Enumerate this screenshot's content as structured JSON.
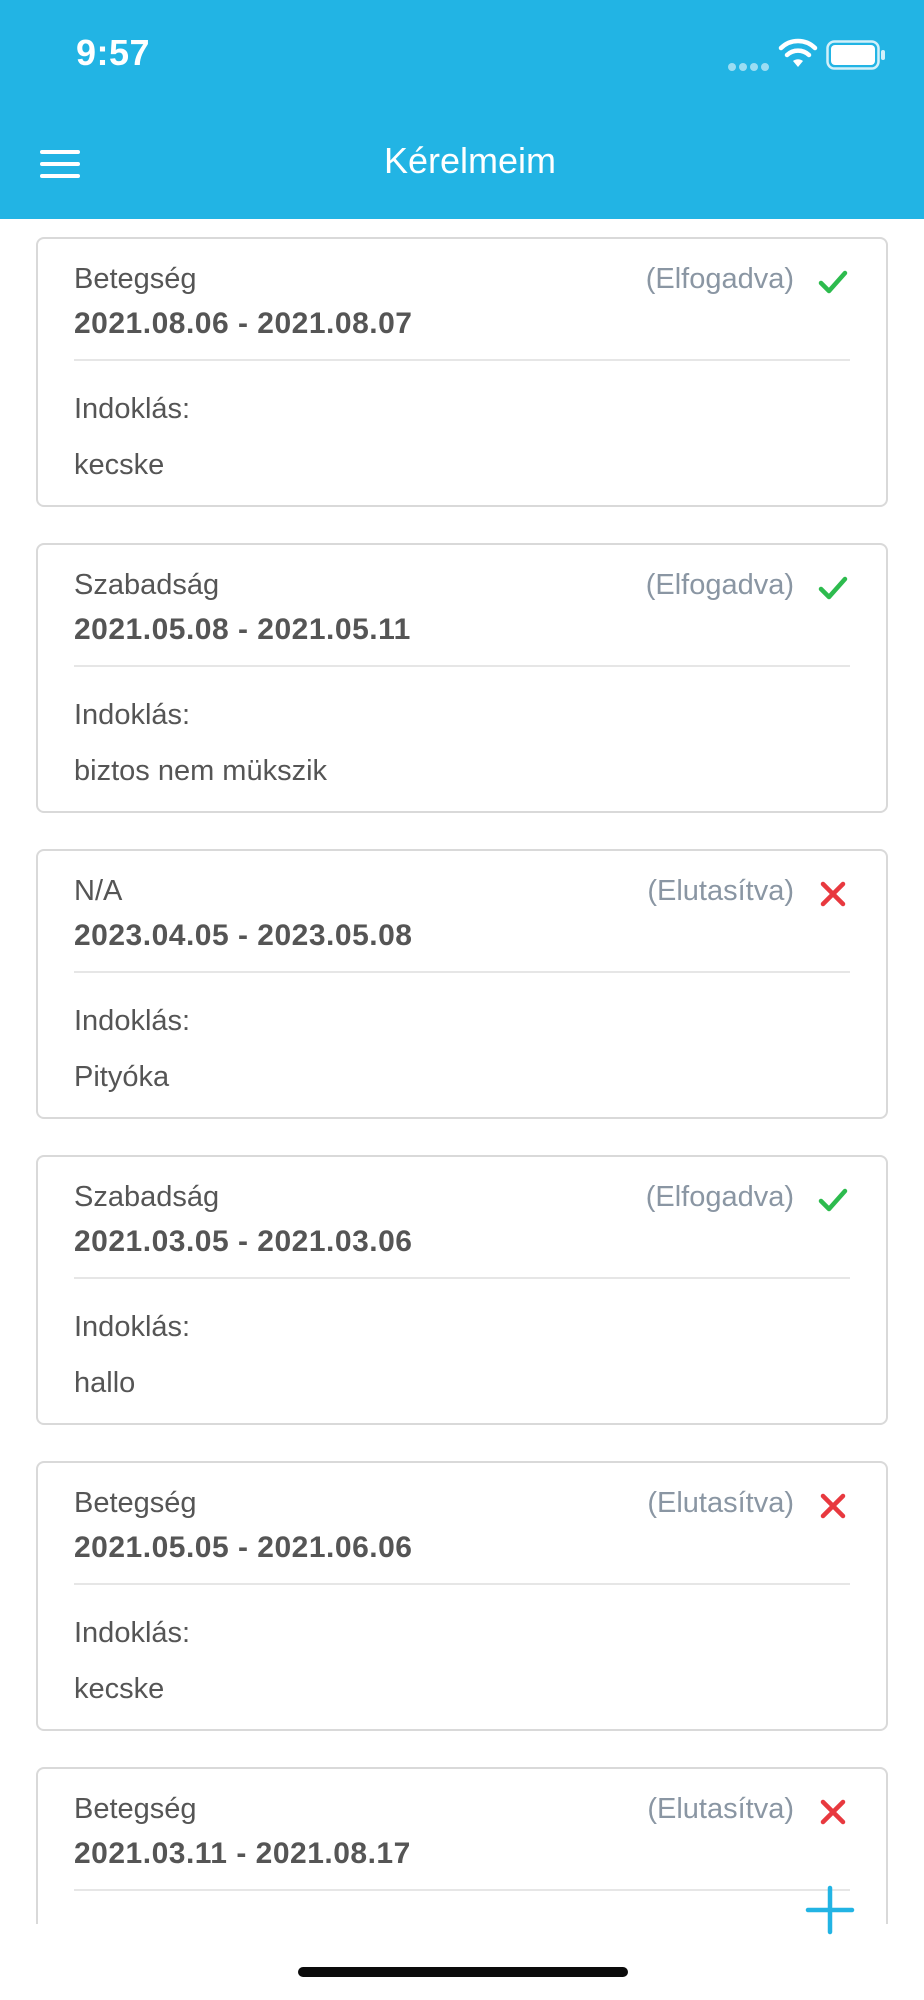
{
  "status_bar": {
    "time": "9:57"
  },
  "header": {
    "title": "Kérelmeim"
  },
  "requests": [
    {
      "type": "Betegség",
      "status": "(Elfogadva)",
      "status_kind": "accepted",
      "dates": "2021.08.06 - 2021.08.07",
      "reason_label": "Indoklás:",
      "reason": "kecske"
    },
    {
      "type": "Szabadság",
      "status": "(Elfogadva)",
      "status_kind": "accepted",
      "dates": "2021.05.08 - 2021.05.11",
      "reason_label": "Indoklás:",
      "reason": "biztos nem mükszik"
    },
    {
      "type": "N/A",
      "status": "(Elutasítva)",
      "status_kind": "rejected",
      "dates": "2023.04.05 - 2023.05.08",
      "reason_label": "Indoklás:",
      "reason": "Pityóka"
    },
    {
      "type": "Szabadság",
      "status": "(Elfogadva)",
      "status_kind": "accepted",
      "dates": "2021.03.05 - 2021.03.06",
      "reason_label": "Indoklás:",
      "reason": "hallo"
    },
    {
      "type": "Betegség",
      "status": "(Elutasítva)",
      "status_kind": "rejected",
      "dates": "2021.05.05 - 2021.06.06",
      "reason_label": "Indoklás:",
      "reason": "kecske"
    },
    {
      "type": "Betegség",
      "status": "(Elutasítva)",
      "status_kind": "rejected",
      "dates": "2021.03.11 - 2021.08.17",
      "reason_label": "Indoklás:",
      "reason": ""
    }
  ],
  "colors": {
    "header_bg": "#22b4e4",
    "accepted": "#2dbb4e",
    "rejected": "#e8393f",
    "status_text": "#8a96a3",
    "fab": "#22b4e4"
  },
  "icons": {
    "menu": "hamburger-menu-icon",
    "accepted": "checkmark-icon",
    "rejected": "x-mark-icon",
    "add": "plus-icon"
  }
}
